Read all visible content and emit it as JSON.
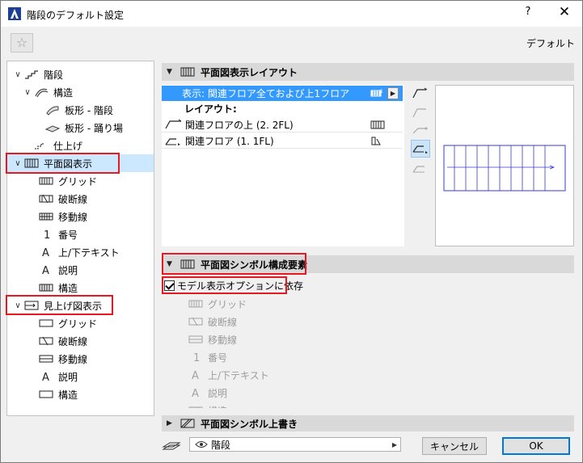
{
  "window": {
    "title": "階段のデフォルト設定",
    "help": "?",
    "close": "✕"
  },
  "favorites": {
    "icon": "☆"
  },
  "default_label": "デフォルト",
  "tree": [
    {
      "label": "階段",
      "chev": "∨"
    },
    {
      "label": "構造",
      "chev": "∨"
    },
    {
      "label": "板形 - 階段",
      "chev": ""
    },
    {
      "label": "板形 - 踊り場",
      "chev": ""
    },
    {
      "label": "仕上げ",
      "chev": ""
    },
    {
      "label": "平面図表示",
      "chev": "∨"
    },
    {
      "label": "グリッド",
      "chev": ""
    },
    {
      "label": "破断線",
      "chev": ""
    },
    {
      "label": "移動線",
      "chev": ""
    },
    {
      "label": "番号",
      "chev": ""
    },
    {
      "label": "上/下テキスト",
      "chev": ""
    },
    {
      "label": "説明",
      "chev": ""
    },
    {
      "label": "構造",
      "chev": ""
    },
    {
      "label": "見上げ図表示",
      "chev": "∨"
    },
    {
      "label": "グリッド",
      "chev": ""
    },
    {
      "label": "破断線",
      "chev": ""
    },
    {
      "label": "移動線",
      "chev": ""
    },
    {
      "label": "説明",
      "chev": ""
    },
    {
      "label": "構造",
      "chev": ""
    }
  ],
  "sections": {
    "layout": {
      "title": "平面図表示レイアウト",
      "expanded": true
    },
    "symbol": {
      "title": "平面図シンボル構成要素",
      "expanded": true
    },
    "override": {
      "title": "平面図シンボル上書き",
      "expanded": false
    }
  },
  "layout_list": {
    "display_row": "表示: 関連フロア全ておよび上1フロア",
    "layout_header": "レイアウト:",
    "rows": [
      {
        "label": "関連フロアの上 (2. 2FL)"
      },
      {
        "label": "関連フロア (1. 1FL)"
      }
    ]
  },
  "checkbox": {
    "label": "モデル表示オプションに依存",
    "checked": true
  },
  "symbol_rows": [
    "グリッド",
    "破断線",
    "移動線",
    "番号",
    "上/下テキスト",
    "説明",
    "構造"
  ],
  "bottom": {
    "combo_value": "階段",
    "cancel": "キャンセル",
    "ok": "OK"
  },
  "colors": {
    "selection": "#3399ff",
    "tree_selected": "#cce8ff",
    "highlight_box": "#e8191e",
    "preview_lines": "#3a3ad0"
  }
}
